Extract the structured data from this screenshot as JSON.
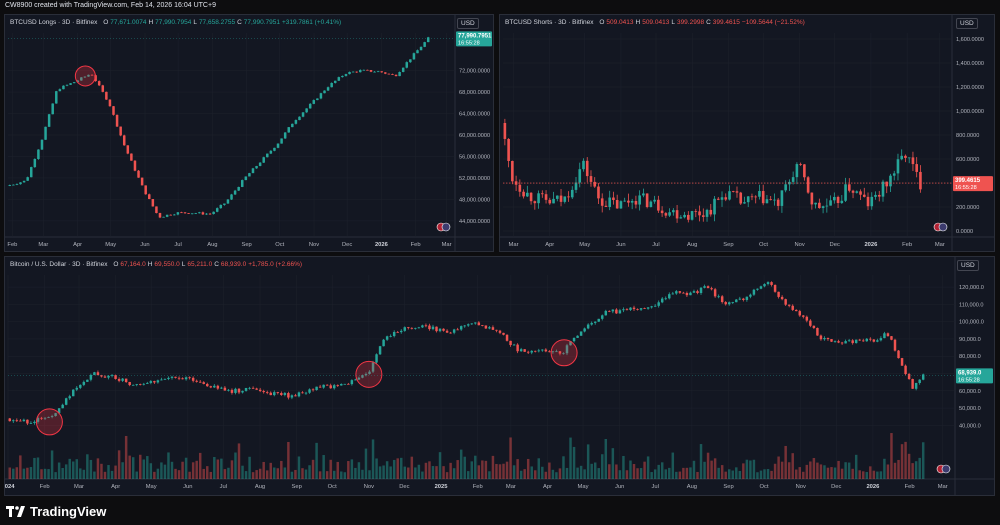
{
  "header": {
    "text": "CW8900 created with TradingView.com, Feb 14, 2026 16:04 UTC+9"
  },
  "footer": {
    "brand": "TradingView"
  },
  "colors": {
    "up": "#26a69a",
    "down": "#ef5350",
    "bg": "#131722",
    "grid": "#1e222d",
    "circle": "#f23645",
    "price_tag": "#26a69a"
  },
  "panels": {
    "longs": {
      "symbol": "BTCUSD Longs · 3D · Bitfinex",
      "ohlc": [
        {
          "k": "O",
          "v": "77,671.0074",
          "c": "up"
        },
        {
          "k": "H",
          "v": "77,990.7954",
          "c": "up"
        },
        {
          "k": "L",
          "v": "77,658.2755",
          "c": "up"
        },
        {
          "k": "C",
          "v": "77,990.7951",
          "c": "up"
        },
        {
          "k": "",
          "v": "+319.7861 (+0.41%)",
          "c": "up"
        }
      ],
      "currency": "USD",
      "price_tag": "77,990.7951",
      "countdown": "16:55:28"
    },
    "shorts": {
      "symbol": "BTCUSD Shorts · 3D · Bitfinex",
      "ohlc": [
        {
          "k": "O",
          "v": "509.0413",
          "c": "dn"
        },
        {
          "k": "H",
          "v": "509.0413",
          "c": "dn"
        },
        {
          "k": "L",
          "v": "399.2998",
          "c": "dn"
        },
        {
          "k": "C",
          "v": "399.4615",
          "c": "dn"
        },
        {
          "k": "",
          "v": "−109.5644 (−21.52%)",
          "c": "dn"
        }
      ],
      "currency": "USD",
      "price_tag": "399.4615",
      "countdown": "16:55:28"
    },
    "btc": {
      "symbol": "Bitcoin / U.S. Dollar · 3D · Bitfinex",
      "ohlc": [
        {
          "k": "O",
          "v": "67,164.0",
          "c": "dn"
        },
        {
          "k": "H",
          "v": "69,550.0",
          "c": "dn"
        },
        {
          "k": "L",
          "v": "65,211.0",
          "c": "dn"
        },
        {
          "k": "C",
          "v": "68,939.0",
          "c": "dn"
        },
        {
          "k": "",
          "v": "+1,785.0 (+2.66%)",
          "c": "dn"
        }
      ],
      "currency": "USD",
      "price_tag": "68,939.0",
      "countdown": "16:55:28"
    }
  },
  "chart_data": [
    {
      "type": "line",
      "title": "BTCUSD Longs · 3D · Bitfinex",
      "x_tick_labels": [
        "Feb",
        "Mar",
        "Apr",
        "May",
        "Jun",
        "Jul",
        "Aug",
        "Sep",
        "Oct",
        "Nov",
        "Dec",
        "2026",
        "Feb",
        "Mar"
      ],
      "y_tick_labels": [
        "72,000.0000",
        "68,000.0000",
        "64,000.0000",
        "60,000.0000",
        "56,000.0000",
        "52,000.0000",
        "48,000.0000",
        "44,000.0000"
      ],
      "ylim": [
        41000,
        79000
      ],
      "series": [
        {
          "x": [
            "2025-01-28",
            "2025-02-15",
            "2025-03-01",
            "2025-03-15",
            "2025-04-01",
            "2025-04-15",
            "2025-05-01",
            "2025-05-15",
            "2025-06-01",
            "2025-06-15",
            "2025-07-01",
            "2025-07-15",
            "2025-08-01",
            "2025-08-15",
            "2025-09-01",
            "2025-09-15",
            "2025-10-01",
            "2025-10-15",
            "2025-11-01",
            "2025-11-15",
            "2025-12-01",
            "2025-12-15",
            "2026-01-01",
            "2026-01-15",
            "2026-02-01",
            "2026-02-14"
          ],
          "values": [
            50500,
            51500,
            59000,
            68500,
            70000,
            71500,
            66000,
            58000,
            50000,
            44700,
            45500,
            45500,
            45300,
            47500,
            52000,
            55000,
            58500,
            62500,
            66000,
            69000,
            71500,
            72000,
            71800,
            71000,
            75000,
            77990
          ]
        }
      ],
      "highlight_circles": [
        {
          "x": "2025-04-08",
          "y": 71000
        }
      ]
    },
    {
      "type": "bar",
      "title": "BTCUSD Shorts · 3D · Bitfinex",
      "x_tick_labels": [
        "Mar",
        "Apr",
        "May",
        "Jun",
        "Jul",
        "Aug",
        "Sep",
        "Oct",
        "Nov",
        "Dec",
        "2026",
        "Feb",
        "Mar"
      ],
      "y_tick_labels": [
        "1,600.0000",
        "1,400.0000",
        "1,200.0000",
        "1,000.0000",
        "800.0000",
        "600.0000",
        "400.0000",
        "200.0000",
        "0.0000"
      ],
      "ylim": [
        -50,
        1650
      ],
      "series": [
        {
          "x": [
            "2025-02-20",
            "2025-03-01",
            "2025-03-15",
            "2025-04-01",
            "2025-04-15",
            "2025-05-01",
            "2025-05-15",
            "2025-06-01",
            "2025-06-15",
            "2025-07-01",
            "2025-07-15",
            "2025-08-01",
            "2025-08-15",
            "2025-09-01",
            "2025-09-15",
            "2025-10-01",
            "2025-10-15",
            "2025-11-01",
            "2025-11-15",
            "2025-12-01",
            "2025-12-15",
            "2026-01-01",
            "2026-01-15",
            "2026-02-01",
            "2026-02-14"
          ],
          "values": [
            900,
            450,
            300,
            240,
            260,
            560,
            260,
            210,
            280,
            230,
            160,
            140,
            160,
            320,
            230,
            280,
            220,
            560,
            200,
            210,
            370,
            220,
            380,
            650,
            399
          ]
        }
      ],
      "reference_line": 399.4615
    },
    {
      "type": "line",
      "title": "Bitcoin / U.S. Dollar · 3D · Bitfinex",
      "x_tick_labels": [
        "2024",
        "Feb",
        "Mar",
        "Apr",
        "May",
        "Jun",
        "Jul",
        "Aug",
        "Sep",
        "Oct",
        "Nov",
        "Dec",
        "2025",
        "Feb",
        "Mar",
        "Apr",
        "May",
        "Jun",
        "Jul",
        "Aug",
        "Sep",
        "Oct",
        "Nov",
        "Dec",
        "2026",
        "Feb",
        "Mar"
      ],
      "y_tick_labels": [
        "120,000.0",
        "110,000.0",
        "100,000.0",
        "90,000.0",
        "80,000.0",
        "70,000.0",
        "60,000.0",
        "50,000.0",
        "40,000.0"
      ],
      "ylim": [
        35000,
        127000
      ],
      "series": [
        {
          "x": [
            "2024-01-01",
            "2024-01-20",
            "2024-02-10",
            "2024-03-01",
            "2024-03-15",
            "2024-04-01",
            "2024-04-20",
            "2024-05-10",
            "2024-06-01",
            "2024-06-20",
            "2024-07-10",
            "2024-08-01",
            "2024-08-15",
            "2024-09-01",
            "2024-09-20",
            "2024-10-10",
            "2024-11-01",
            "2024-11-15",
            "2024-12-01",
            "2024-12-20",
            "2025-01-10",
            "2025-02-01",
            "2025-02-20",
            "2025-03-10",
            "2025-04-01",
            "2025-04-15",
            "2025-05-01",
            "2025-05-20",
            "2025-06-10",
            "2025-07-01",
            "2025-07-15",
            "2025-08-01",
            "2025-08-15",
            "2025-09-01",
            "2025-09-20",
            "2025-10-06",
            "2025-10-20",
            "2025-11-05",
            "2025-11-20",
            "2025-12-10",
            "2026-01-01",
            "2026-01-15",
            "2026-02-05",
            "2026-02-14"
          ],
          "values": [
            44000,
            41500,
            47000,
            62000,
            70000,
            68000,
            63000,
            67000,
            68000,
            63000,
            60000,
            61000,
            58000,
            57000,
            62000,
            63000,
            69000,
            90000,
            96000,
            97000,
            94000,
            100000,
            94000,
            83000,
            84000,
            82000,
            95000,
            105000,
            107000,
            108000,
            117000,
            116000,
            120000,
            110000,
            115000,
            124000,
            110000,
            103000,
            90000,
            88000,
            89000,
            93000,
            62000,
            68939
          ]
        }
      ],
      "highlight_circles": [
        {
          "x": "2024-02-05",
          "y": 42000
        },
        {
          "x": "2024-11-01",
          "y": 69500
        },
        {
          "x": "2025-04-15",
          "y": 82000
        }
      ]
    }
  ]
}
